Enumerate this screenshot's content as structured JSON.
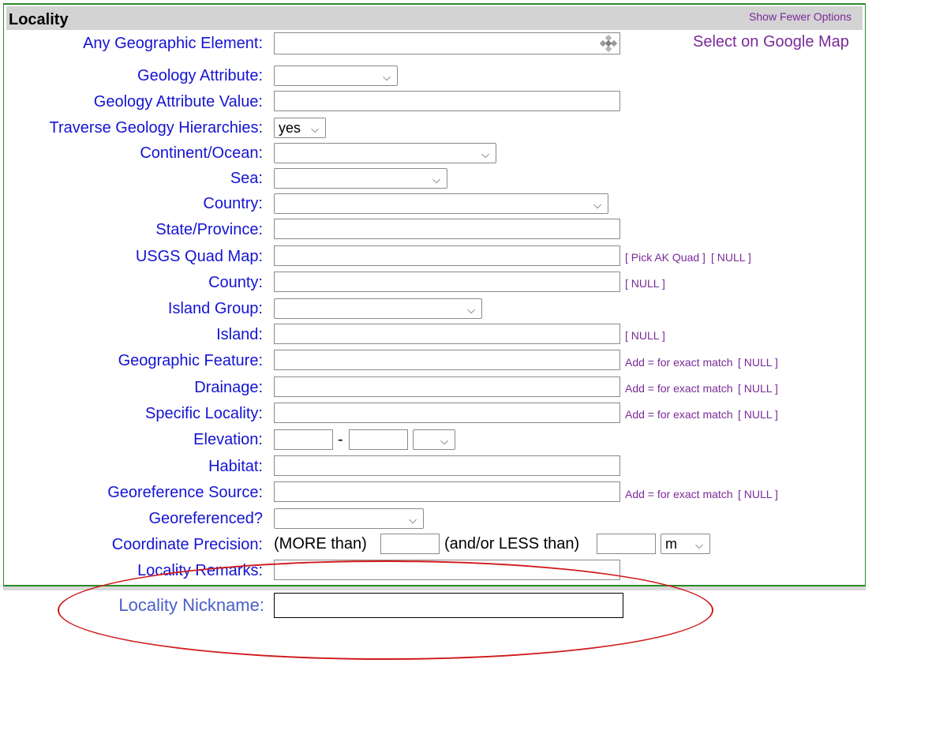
{
  "header": {
    "title": "Locality",
    "toggle_label": "Show Fewer Options"
  },
  "map_link": "Select on Google Map",
  "fields": {
    "any_geo": "Any Geographic Element:",
    "geology_attribute": "Geology Attribute:",
    "geology_attribute_value": "Geology Attribute Value:",
    "traverse_hierarchies": "Traverse Geology Hierarchies:",
    "continent_ocean": "Continent/Ocean:",
    "sea": "Sea:",
    "country": "Country:",
    "state_province": "State/Province:",
    "usgs_quad": "USGS Quad Map:",
    "county": "County:",
    "island_group": "Island Group:",
    "island": "Island:",
    "geographic_feature": "Geographic Feature:",
    "drainage": "Drainage:",
    "specific_locality": "Specific Locality:",
    "elevation": "Elevation:",
    "habitat": "Habitat:",
    "georeference_source": "Georeference Source:",
    "georeferenced": "Georeferenced?",
    "coordinate_precision": "Coordinate Precision:",
    "locality_remarks": "Locality Remarks:",
    "locality_nickname": "Locality Nickname:"
  },
  "values": {
    "traverse_hierarchies": "yes",
    "precision_unit": "m"
  },
  "links": {
    "pick_ak_quad": "[ Pick AK Quad ]",
    "null": "[ NULL ]",
    "exact_match": "Add = for exact match"
  },
  "text": {
    "elevation_dash": "-",
    "more_than": "(MORE than)",
    "less_than": "(and/or LESS than)"
  },
  "icons": {
    "geo_picker": "grid-diamond-icon",
    "dropdown": "chevron-down-icon"
  },
  "colors": {
    "label": "#1414d2",
    "link": "#7a2a98",
    "border": "#2a8a2a",
    "highlight": "#d01a1a"
  }
}
